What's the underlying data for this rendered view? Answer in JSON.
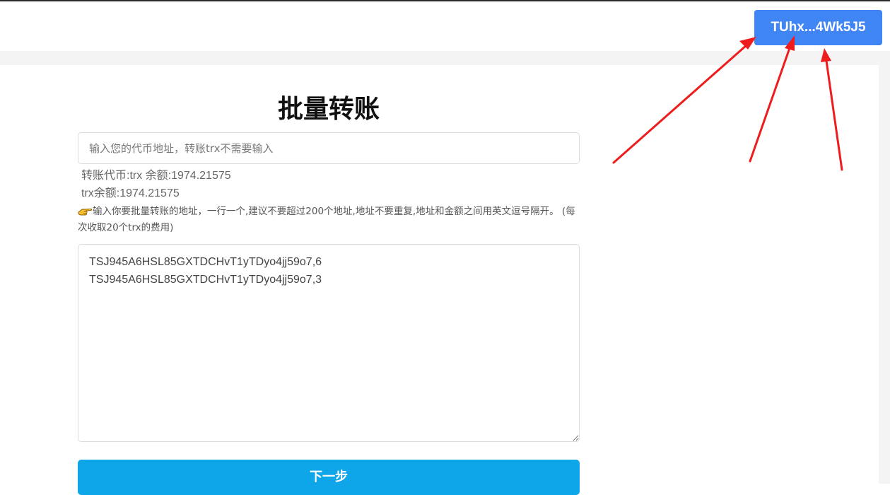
{
  "header": {
    "wallet_address": "TUhx...4Wk5J5"
  },
  "form": {
    "title": "批量转账",
    "token_input_placeholder": "输入您的代币地址，转账trx不需要输入",
    "token_balance_line": "转账代币:trx 余额:1974.21575",
    "trx_balance_line": "trx余额:1974.21575",
    "instruction_text": "输入你要批量转账的地址，一行一个,建议不要超过200个地址,地址不要重复,地址和金额之间用英文逗号隔开。 (每次收取20个trx的费用)",
    "instruction_icon": "pointing-hand-icon",
    "addresses_value": "TSJ945A6HSL85GXTDCHvT1yTDyo4jj59o7,6\nTSJ945A6HSL85GXTDCHvT1yTDyo4jj59o7,3",
    "next_button_label": "下一步"
  },
  "colors": {
    "wallet_button": "#3f85f4",
    "next_button": "#0ea5e9",
    "annotation_arrow": "#ee1c1c"
  }
}
